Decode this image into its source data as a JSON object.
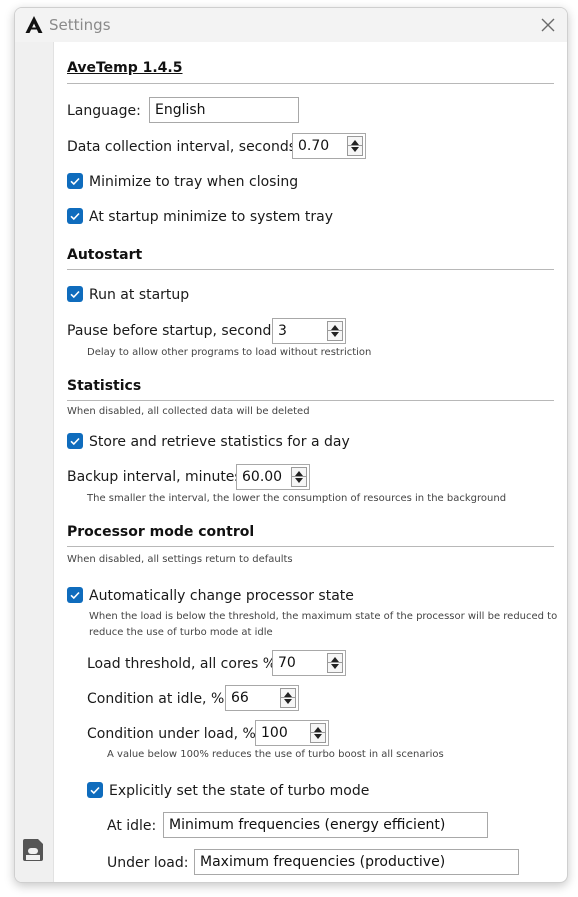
{
  "window": {
    "title": "Settings"
  },
  "general": {
    "app_header": "AveTemp 1.4.5",
    "language_label": "Language:",
    "language_value": "English",
    "interval_label": "Data collection interval, seconds:",
    "interval_value": "0.70",
    "minimize_tray_label": "Minimize to tray when closing",
    "minimize_tray_checked": true,
    "startup_minimize_label": "At startup minimize to system tray",
    "startup_minimize_checked": true
  },
  "autostart": {
    "header": "Autostart",
    "run_at_startup_label": "Run at startup",
    "run_at_startup_checked": true,
    "pause_label": "Pause before startup, seconds:",
    "pause_value": "3",
    "pause_hint": "Delay to allow other programs to load without restriction"
  },
  "statistics": {
    "header": "Statistics",
    "hint": "When disabled, all collected data will be deleted",
    "store_label": "Store and retrieve statistics for a day",
    "store_checked": true,
    "backup_label": "Backup interval, minutes:",
    "backup_value": "60.00",
    "backup_hint": "The smaller the interval, the lower the consumption of resources in the background"
  },
  "processor": {
    "header": "Processor mode control",
    "hint": "When disabled, all settings return to defaults",
    "auto_change_label": "Automatically change processor state",
    "auto_change_checked": true,
    "auto_change_hint_1": "When the load is below the threshold, the maximum state of the processor will be reduced to",
    "auto_change_hint_2": "reduce the use of turbo mode at idle",
    "threshold_label": "Load threshold, all cores %:",
    "threshold_value": "70",
    "idle_label": "Condition at idle, %:",
    "idle_value": "66",
    "load_label": "Condition under load, %:",
    "load_value": "100",
    "load_hint": "A value below 100% reduces the use of turbo boost in all scenarios",
    "turbo_label": "Explicitly set the state of turbo mode",
    "turbo_checked": true,
    "at_idle_label": "At idle:",
    "at_idle_value": "Minimum frequencies (energy efficient)",
    "under_load_label": "Under load:",
    "under_load_value": "Maximum frequencies (productive)"
  },
  "icons": {
    "logo": "avetemp-logo-icon",
    "close": "close-icon",
    "save": "save-icon",
    "check": "checkmark-icon"
  },
  "colors": {
    "accent": "#0f6cbd",
    "titlebar": "#f3f3f3",
    "sidebar": "#f0f0f0"
  }
}
